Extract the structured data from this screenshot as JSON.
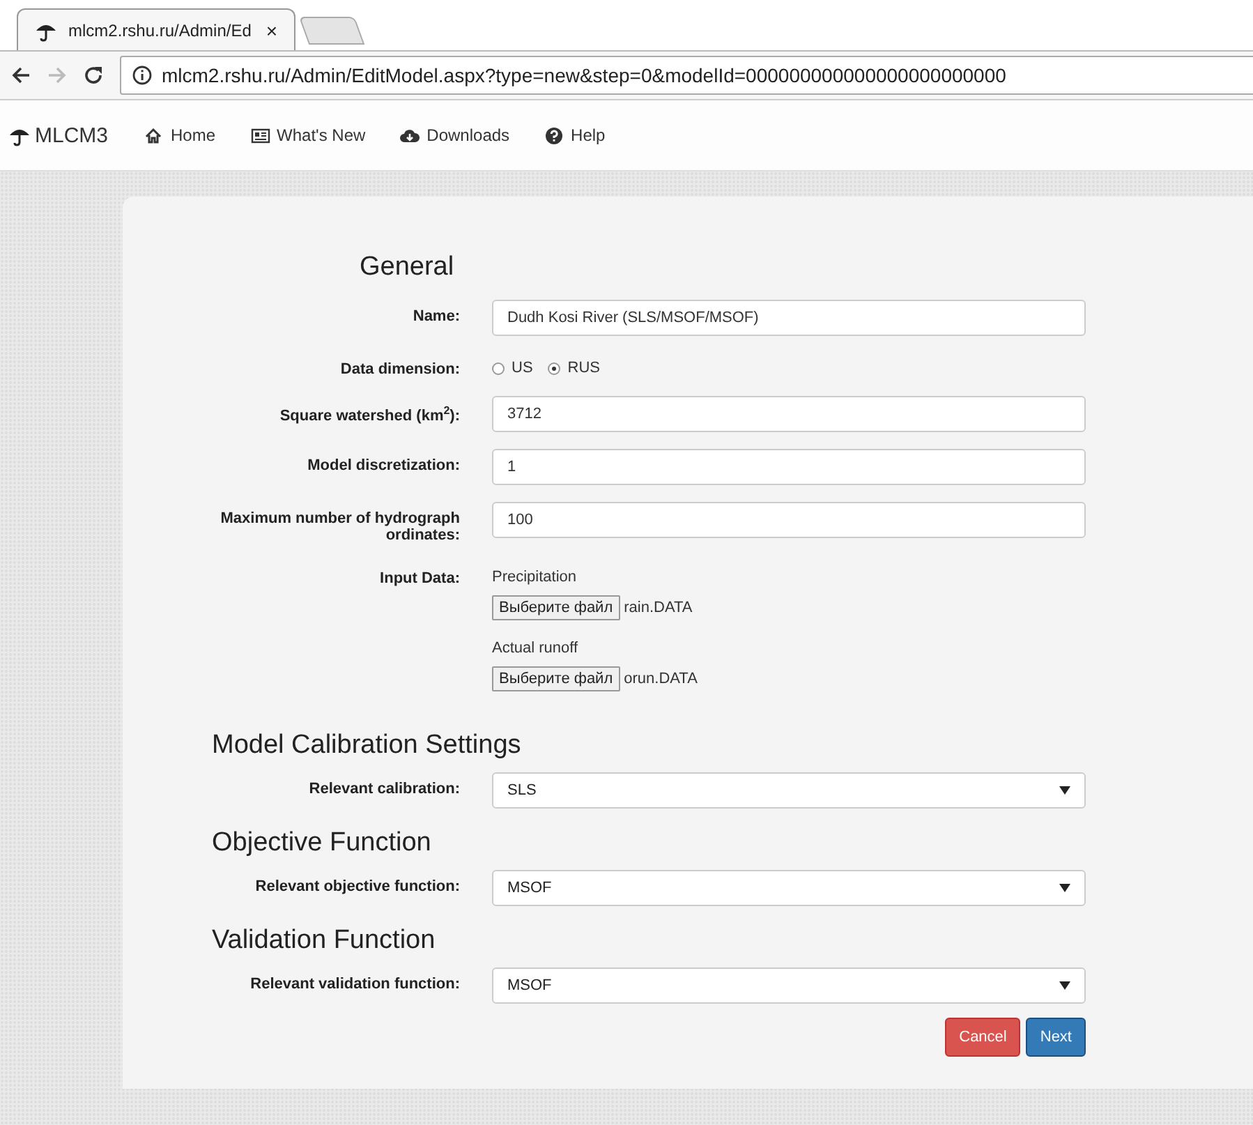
{
  "browser": {
    "tab_title": "mlcm2.rshu.ru/Admin/Ed",
    "tab_close": "×",
    "url": "mlcm2.rshu.ru/Admin/EditModel.aspx?type=new&step=0&modelId=000000000000000000000000"
  },
  "nav": {
    "brand": "MLCM3",
    "items": [
      {
        "label": "Home"
      },
      {
        "label": "What's New"
      },
      {
        "label": "Downloads"
      },
      {
        "label": "Help"
      }
    ]
  },
  "sections": [
    {
      "title": "General",
      "fields": [
        {
          "kind": "text",
          "label": "Name:",
          "value": "Dudh Kosi River (SLS/MSOF/MSOF)"
        },
        {
          "kind": "radio",
          "label": "Data dimension:",
          "options": [
            {
              "label": "US",
              "selected": false
            },
            {
              "label": "RUS",
              "selected": true
            }
          ]
        },
        {
          "kind": "text",
          "label": "Square watershed (km$^{2}$):",
          "value": "3712"
        },
        {
          "kind": "text",
          "label": "Model discretization:",
          "value": "1"
        },
        {
          "kind": "text",
          "label": "Maximum number of hydrograph ordinates:",
          "value": "100"
        },
        {
          "kind": "files",
          "label": "Input Data:",
          "files": [
            {
              "caption": "Precipitation",
              "button": "Выберите файл",
              "filename": "rain.DATA"
            },
            {
              "caption": "Actual runoff",
              "button": "Выберите файл",
              "filename": "orun.DATA"
            }
          ]
        }
      ]
    },
    {
      "title": "Model Calibration Settings",
      "fields": [
        {
          "kind": "select",
          "label": "Relevant calibration:",
          "value": "SLS"
        }
      ]
    },
    {
      "title": "Objective Function",
      "fields": [
        {
          "kind": "select",
          "label": "Relevant objective function:",
          "value": "MSOF"
        }
      ]
    },
    {
      "title": "Validation Function",
      "fields": [
        {
          "kind": "select",
          "label": "Relevant validation function:",
          "value": "MSOF"
        }
      ]
    }
  ],
  "buttons": [
    {
      "label": "Cancel",
      "kind": "cancel"
    },
    {
      "label": "Next",
      "kind": "next"
    }
  ]
}
